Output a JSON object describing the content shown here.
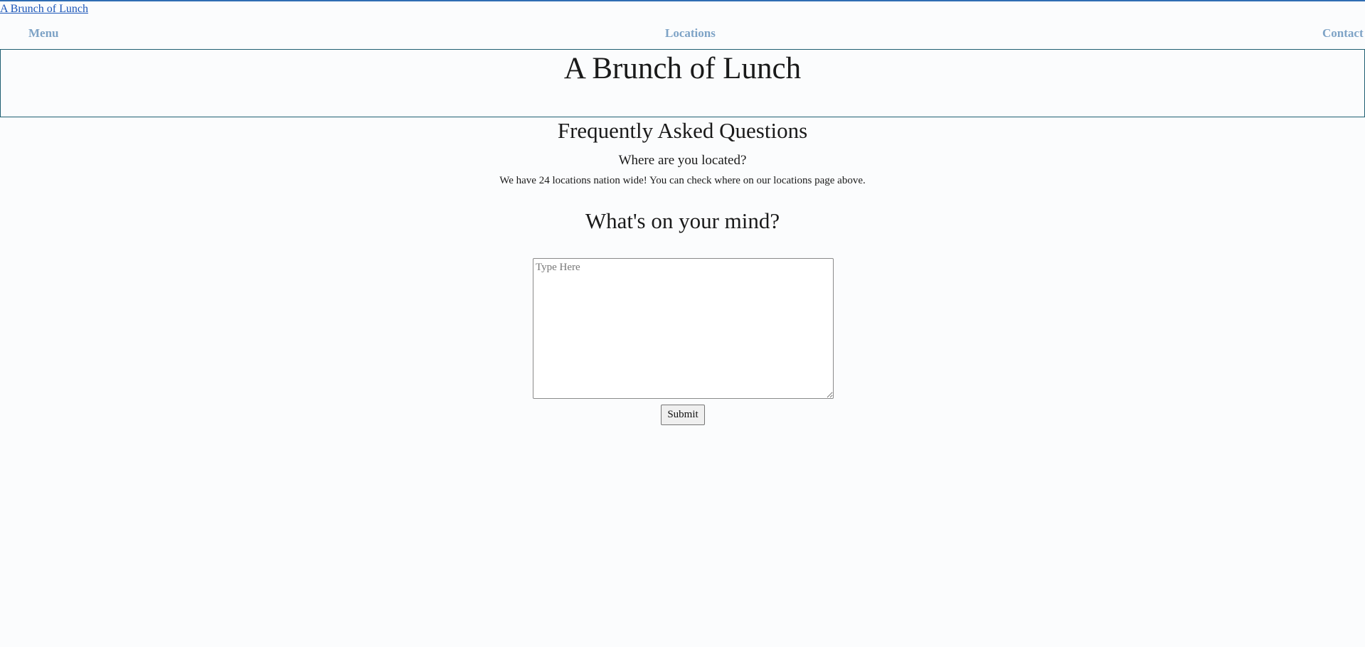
{
  "site": {
    "home_link": "A Brunch of Lunch",
    "title": "A Brunch of Lunch"
  },
  "nav": {
    "items": [
      {
        "label": "Menu"
      },
      {
        "label": "Locations"
      },
      {
        "label": "Contact"
      }
    ]
  },
  "faq": {
    "heading": "Frequently Asked Questions",
    "question": "Where are you located?",
    "answer": "We have 24 locations nation wide! You can check where on our locations page above."
  },
  "feedback": {
    "heading": "What's on your mind?",
    "placeholder": "Type Here",
    "value": "",
    "submit_label": "Submit"
  },
  "colors": {
    "top_rule": "#2f6db3",
    "link": "#1a55b8",
    "nav_text": "#7ea3c6",
    "banner_border": "#1f5f72",
    "background": "#fbfcfd"
  }
}
